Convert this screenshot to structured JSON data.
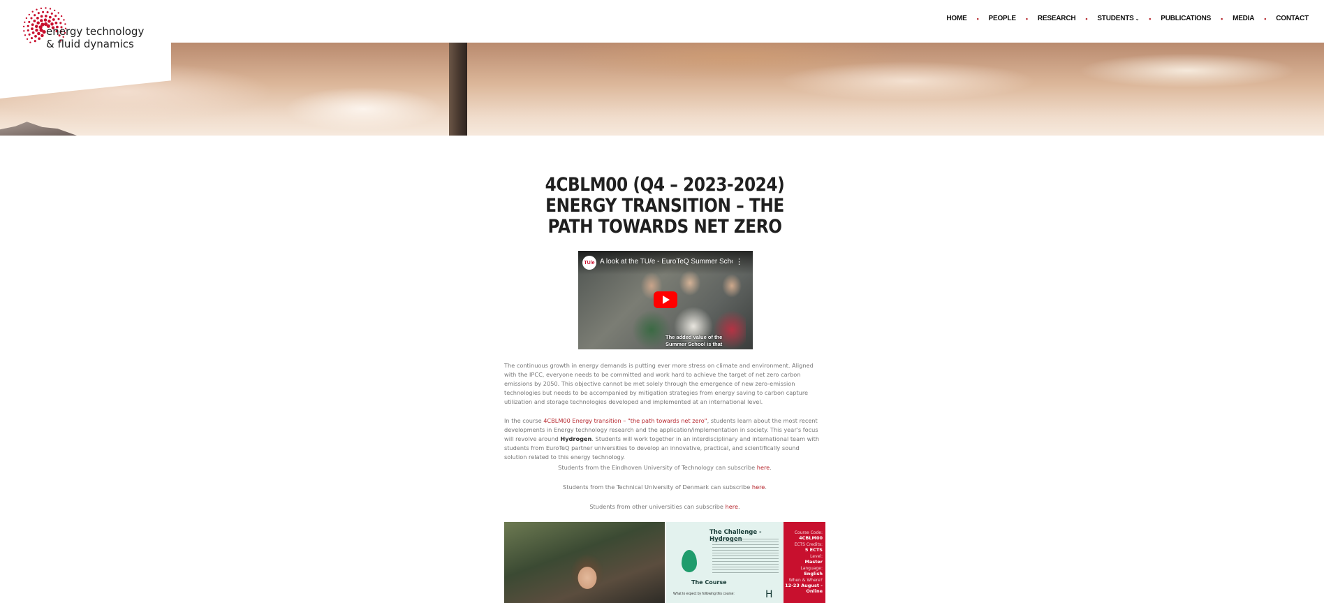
{
  "logo": {
    "line1": "energy technology",
    "line2": "& fluid dynamics"
  },
  "nav": {
    "items": [
      "HOME",
      "PEOPLE",
      "RESEARCH",
      "STUDENTS",
      "PUBLICATIONS",
      "MEDIA",
      "CONTACT"
    ],
    "separator": "•",
    "dropdown_caret": "⌄"
  },
  "page": {
    "title": "4CBLM00 (Q4 – 2023-2024) ENERGY TRANSITION – THE PATH TOWARDS NET ZERO"
  },
  "video": {
    "channel": "TU/e",
    "title": "A look at the TU/e - EuroTeQ Summer School ...",
    "menu": "⋮",
    "caption_line1": "The added value of the",
    "caption_line2": "Summer School is that"
  },
  "para1": "The continuous growth in energy demands is putting ever more stress on climate and environment. Aligned with the IPCC, everyone needs to be committed and work hard to achieve the target of net zero carbon emissions by 2050. This objective cannot be met solely through the emergence of new zero-emission technologies but needs to be accompanied by mitigation strategies from energy saving to carbon capture utilization and storage technologies developed and implemented at an international level.",
  "para2": {
    "pre": "In the course ",
    "link": "4CBLM00 Energy transition – \"the path towards net zero\"",
    "mid": ", students learn about the most recent developments in Energy technology research and the application/implementation in society. This year's focus will revolve around ",
    "bold": "Hydrogen",
    "post": ". Students will work together in an interdisciplinary and international team with students from EuroTeQ partner universities to develop an innovative, practical, and scientifically sound solution related to this energy technology."
  },
  "subscribe": [
    {
      "text": "Students from the Eindhoven University of Technology can subscribe ",
      "link": "here"
    },
    {
      "text": "Students from the Technical University of Denmark can subscribe ",
      "link": "here"
    },
    {
      "text": "Students from other universities can subscribe ",
      "link": "here"
    }
  ],
  "gallery": {
    "challenge_title": "The Challenge - Hydrogen",
    "course_title": "The Course",
    "course_text": "What to expect by following this course:",
    "h_label": "H",
    "info": [
      {
        "key": "Course Code:",
        "value": "4CBLM00"
      },
      {
        "key": "ECTS Credits:",
        "value": "5 ECTS"
      },
      {
        "key": "Level:",
        "value": "Master"
      },
      {
        "key": "Language:",
        "value": "English"
      },
      {
        "key": "When & Where?",
        "value": "12-23 August - Online"
      }
    ]
  },
  "colors": {
    "accent": "#b6262d",
    "text": "#777777",
    "title": "#1f1f1f"
  }
}
